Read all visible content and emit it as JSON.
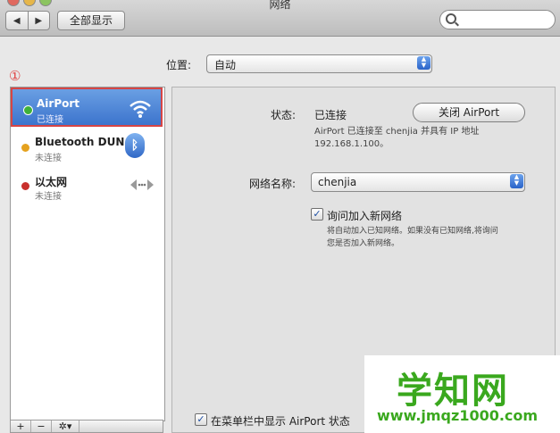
{
  "window": {
    "title": "网络"
  },
  "toolbar": {
    "back_glyph": "◀",
    "forward_glyph": "▶",
    "show_all_label": "全部显示",
    "search_placeholder": ""
  },
  "location": {
    "label": "位置:",
    "value": "自动"
  },
  "annotation": {
    "marker": "①"
  },
  "sidebar": {
    "services": [
      {
        "name": "AirPort",
        "status": "已连接",
        "dot_color": "#3fb13a",
        "icon": "wifi-icon",
        "selected": true
      },
      {
        "name": "Bluetooth DUN",
        "status": "未连接",
        "dot_color": "#e5a21f",
        "icon": "bluetooth-icon",
        "selected": false
      },
      {
        "name": "以太网",
        "status": "未连接",
        "dot_color": "#c9302c",
        "icon": "ethernet-icon",
        "selected": false
      }
    ],
    "bottom_buttons": [
      "+",
      "−",
      "✲▾"
    ]
  },
  "detail": {
    "status_label": "状态:",
    "status_value": "已连接",
    "turn_off_button": "关闭 AirPort",
    "status_desc_line1": "AirPort 已连接至 chenjia 并具有 IP 地址",
    "status_desc_line2": "192.168.1.100。",
    "network_name_label": "网络名称:",
    "network_name_value": "chenjia",
    "ask_join_label": "询问加入新网络",
    "ask_join_checked": true,
    "ask_join_desc_line1": "将自动加入已知网络。如果没有已知网络,将询问",
    "ask_join_desc_line2": "您是否加入新网络。",
    "show_menu_label": "在菜单栏中显示 AirPort 状态",
    "show_menu_checked": true
  },
  "watermark": {
    "text": "学知网",
    "url": "www.jmqz1000.com"
  },
  "colors": {
    "selection": "#3c74cd",
    "highlight_border": "#d64545",
    "watermark": "#3aa81e"
  }
}
